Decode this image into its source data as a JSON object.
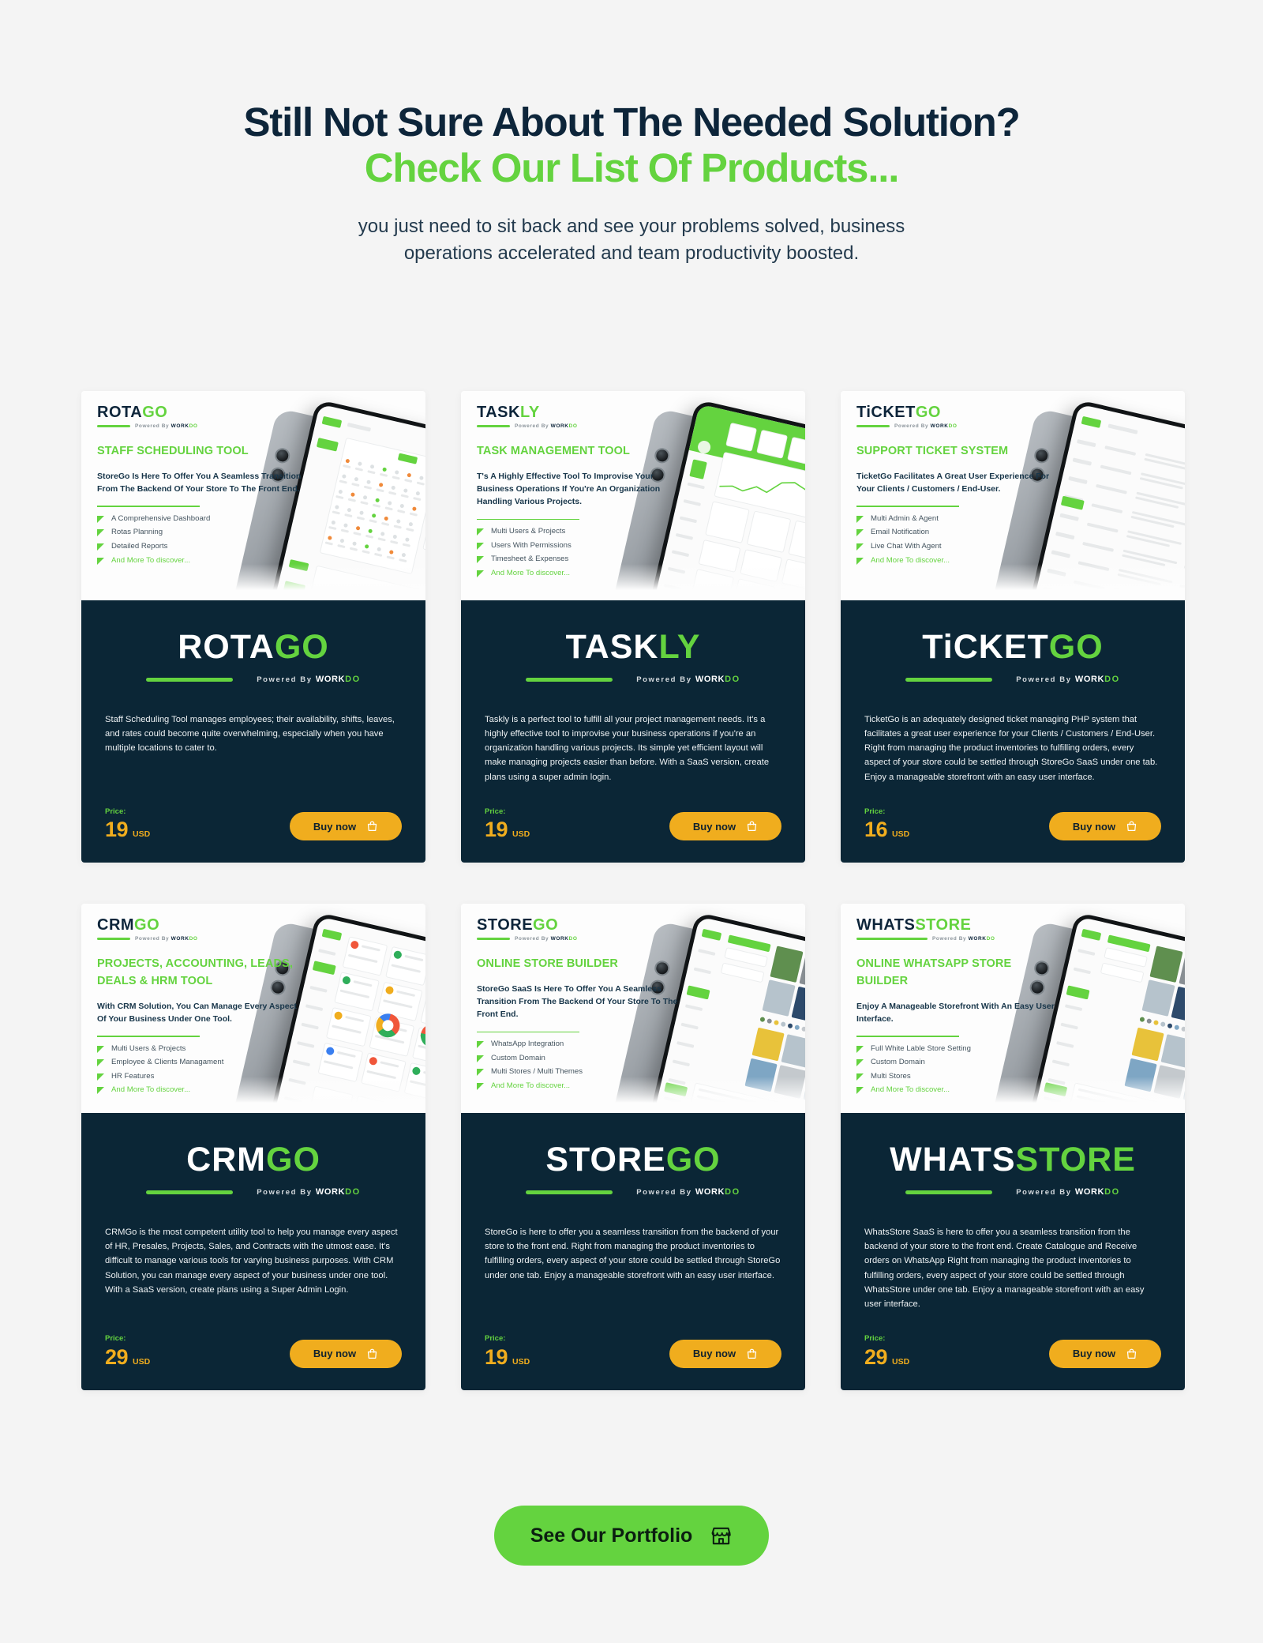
{
  "header": {
    "title_line1": "Still Not Sure About The Needed Solution?",
    "title_line2": "Check Our List Of Products...",
    "subtitle": "you just need to sit back and see your problems solved, business operations accelerated and team productivity boosted."
  },
  "colors": {
    "green": "#64d33f",
    "dark_navy": "#0b2636",
    "yellow": "#f0ad1e",
    "page_bg": "#f4f4f4",
    "heading_dark": "#0d253a"
  },
  "powered_by": {
    "prefix": "Powered By",
    "brand_dark": "WORK",
    "brand_green": "DO"
  },
  "common": {
    "price_label": "Price:",
    "currency": "USD",
    "buy_label": "Buy now",
    "more_feature": "And More To discover..."
  },
  "cards": [
    {
      "logo_dark": "ROTA",
      "logo_green": "GO",
      "promo_title": "STAFF SCHEDULING TOOL",
      "promo_desc": "StoreGo Is Here To Offer You A Seamless Transition From The Backend Of Your Store To The Front End.",
      "features": [
        "A Comprehensive Dashboard",
        "Rotas Planning",
        "Detailed Reports",
        "And More To discover..."
      ],
      "description": "Staff Scheduling Tool manages employees; their availability, shifts, leaves, and rates could become quite overwhelming, especially when you have multiple locations to cater to.",
      "price": "19",
      "currency": "USD",
      "buy_label": "Buy now",
      "screen": "calendar"
    },
    {
      "logo_dark": "TASK",
      "logo_green": "LY",
      "promo_title": "TASK MANAGEMENT TOOL",
      "promo_desc": "T's A Highly Effective Tool To Improvise Your Business Operations If You're An Organization Handling Various Projects.",
      "features": [
        "Multi Users & Projects",
        "Users With Permissions",
        "Timesheet & Expenses",
        "And More To discover..."
      ],
      "description": "Taskly is a perfect tool to fulfill all your project management needs. It's a highly effective tool to improvise your business operations if you're an organization handling various projects. Its simple yet efficient layout will make managing projects easier than before. With a SaaS version, create plans using a super admin login.",
      "price": "19",
      "currency": "USD",
      "buy_label": "Buy now",
      "screen": "chart"
    },
    {
      "logo_dark": "TiCKET",
      "logo_green": "GO",
      "promo_title": "SUPPORT TICKET SYSTEM",
      "promo_desc": "TicketGo Facilitates A Great User Experience For Your Clients / Customers / End-User.",
      "features": [
        "Multi Admin & Agent",
        "Email Notification",
        "Live Chat With Agent",
        "And More To discover..."
      ],
      "description": "TicketGo is an adequately designed ticket managing PHP system that facilitates a great user experience for your Clients / Customers / End-User. Right from managing the product inventories to fulfilling orders, every aspect of your store could be settled through StoreGo SaaS under one tab. Enjoy a manageable storefront with an easy user interface.",
      "price": "16",
      "currency": "USD",
      "buy_label": "Buy now",
      "screen": "list"
    },
    {
      "logo_dark": "CRM",
      "logo_green": "GO",
      "promo_title": "PROJECTS, ACCOUNTING, LEADS, DEALS & HRM TOOL",
      "promo_desc": "With CRM Solution, You Can Manage Every Aspect Of Your Business Under One Tool.",
      "features": [
        "Multi Users & Projects",
        "Employee & Clients Managament",
        "HR Features",
        "And More To discover..."
      ],
      "description": "CRMGo  is the most competent utility tool to help you manage every aspect of HR, Presales, Projects, Sales, and Contracts with the utmost ease. It's difficult to manage various tools for varying business purposes. With CRM Solution, you can manage every aspect of your business under one tool. With a SaaS version, create plans using a Super Admin Login.",
      "price": "29",
      "currency": "USD",
      "buy_label": "Buy now",
      "screen": "donut"
    },
    {
      "logo_dark": "STORE",
      "logo_green": "GO",
      "promo_title": "ONLINE STORE BUILDER",
      "promo_desc": "StoreGo SaaS Is Here To Offer You A Seamless Transition From The Backend Of Your Store To The Front End.",
      "features": [
        "WhatsApp Integration",
        "Custom Domain",
        "Multi Stores / Multi Themes",
        "And More To discover..."
      ],
      "description": "StoreGo is here to offer you a seamless transition from the backend of your store to the front end. Right from managing the product inventories to fulfilling orders, every aspect of your store could be settled through StoreGo under one tab. Enjoy a manageable storefront with an easy user interface.",
      "price": "19",
      "currency": "USD",
      "buy_label": "Buy now",
      "screen": "gallery"
    },
    {
      "logo_dark": "WHATS",
      "logo_green": "STORE",
      "promo_title": "ONLINE WHATSAPP STORE BUILDER",
      "promo_desc": "Enjoy A Manageable Storefront With An Easy User Interface.",
      "features": [
        "Full White Lable Store Setting",
        "Custom Domain",
        "Multi Stores",
        "And More To discover..."
      ],
      "description": "WhatsStore SaaS is here to offer you a seamless transition from the backend of your store to the front end. Create Catalogue and Receive orders on WhatsApp Right from managing the product inventories to fulfilling orders, every aspect of your store could be settled through WhatsStore under one tab. Enjoy a manageable storefront with an easy user interface.",
      "price": "29",
      "currency": "USD",
      "buy_label": "Buy now",
      "screen": "gallery"
    }
  ],
  "portfolio_button": {
    "label": "See Our Portfolio",
    "icon": "storefront-icon"
  }
}
